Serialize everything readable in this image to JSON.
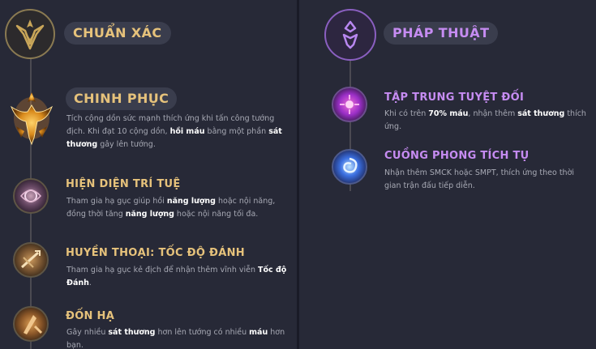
{
  "primary": {
    "title": "CHUẨN XÁC",
    "accent": "#e6c27b",
    "emblem_icon": "precision-crest-icon",
    "keystone": {
      "name": "CHINH PHỤC",
      "icon": "conqueror-icon",
      "desc": {
        "t1": "Tích cộng dồn sức mạnh thích ứng khi tấn công tướng địch. Khi đạt 10 cộng dồn, ",
        "b1": "hồi máu",
        "t2": " bằng một phần ",
        "b2": "sát thương",
        "t3": " gây lên tướng."
      }
    },
    "runes": [
      {
        "name": "HIỆN DIỆN TRÍ TUỆ",
        "icon": "presence-of-mind-icon",
        "desc": {
          "t1": "Tham gia hạ gục giúp hồi ",
          "b1": "năng lượng",
          "t2": " hoặc nội năng, đồng thời tăng ",
          "b2": "năng lượng",
          "t3": " hoặc nội năng tối đa."
        }
      },
      {
        "name": "HUYỀN THOẠI: TỐC ĐỘ ĐÁNH",
        "icon": "legend-alacrity-icon",
        "desc": {
          "t1": "Tham gia hạ gục kẻ địch để nhận thêm vĩnh viễn ",
          "b1": "Tốc độ Đánh",
          "t2": "."
        }
      },
      {
        "name": "ĐỐN HẠ",
        "icon": "cut-down-icon",
        "desc": {
          "t1": "Gây nhiều ",
          "b1": "sát thương",
          "t2": " hơn lên tướng có nhiều ",
          "b2": "máu",
          "t3": " hơn bạn."
        }
      }
    ]
  },
  "secondary": {
    "title": "PHÁP THUẬT",
    "accent": "#c68cf2",
    "emblem_icon": "sorcery-crest-icon",
    "runes": [
      {
        "name": "TẬP TRUNG TUYỆT ĐỐI",
        "icon": "absolute-focus-icon",
        "desc": {
          "t1": "Khi có trên ",
          "b1": "70% máu",
          "t2": ", nhận thêm ",
          "b2": "sát thương",
          "t3": " thích ứng."
        }
      },
      {
        "name": "CUỒNG PHONG TÍCH TỤ",
        "icon": "gathering-storm-icon",
        "desc": {
          "t1": "Nhận thêm SMCK hoặc SMPT, thích ứng theo thời gian trận đấu tiếp diễn."
        }
      }
    ]
  }
}
